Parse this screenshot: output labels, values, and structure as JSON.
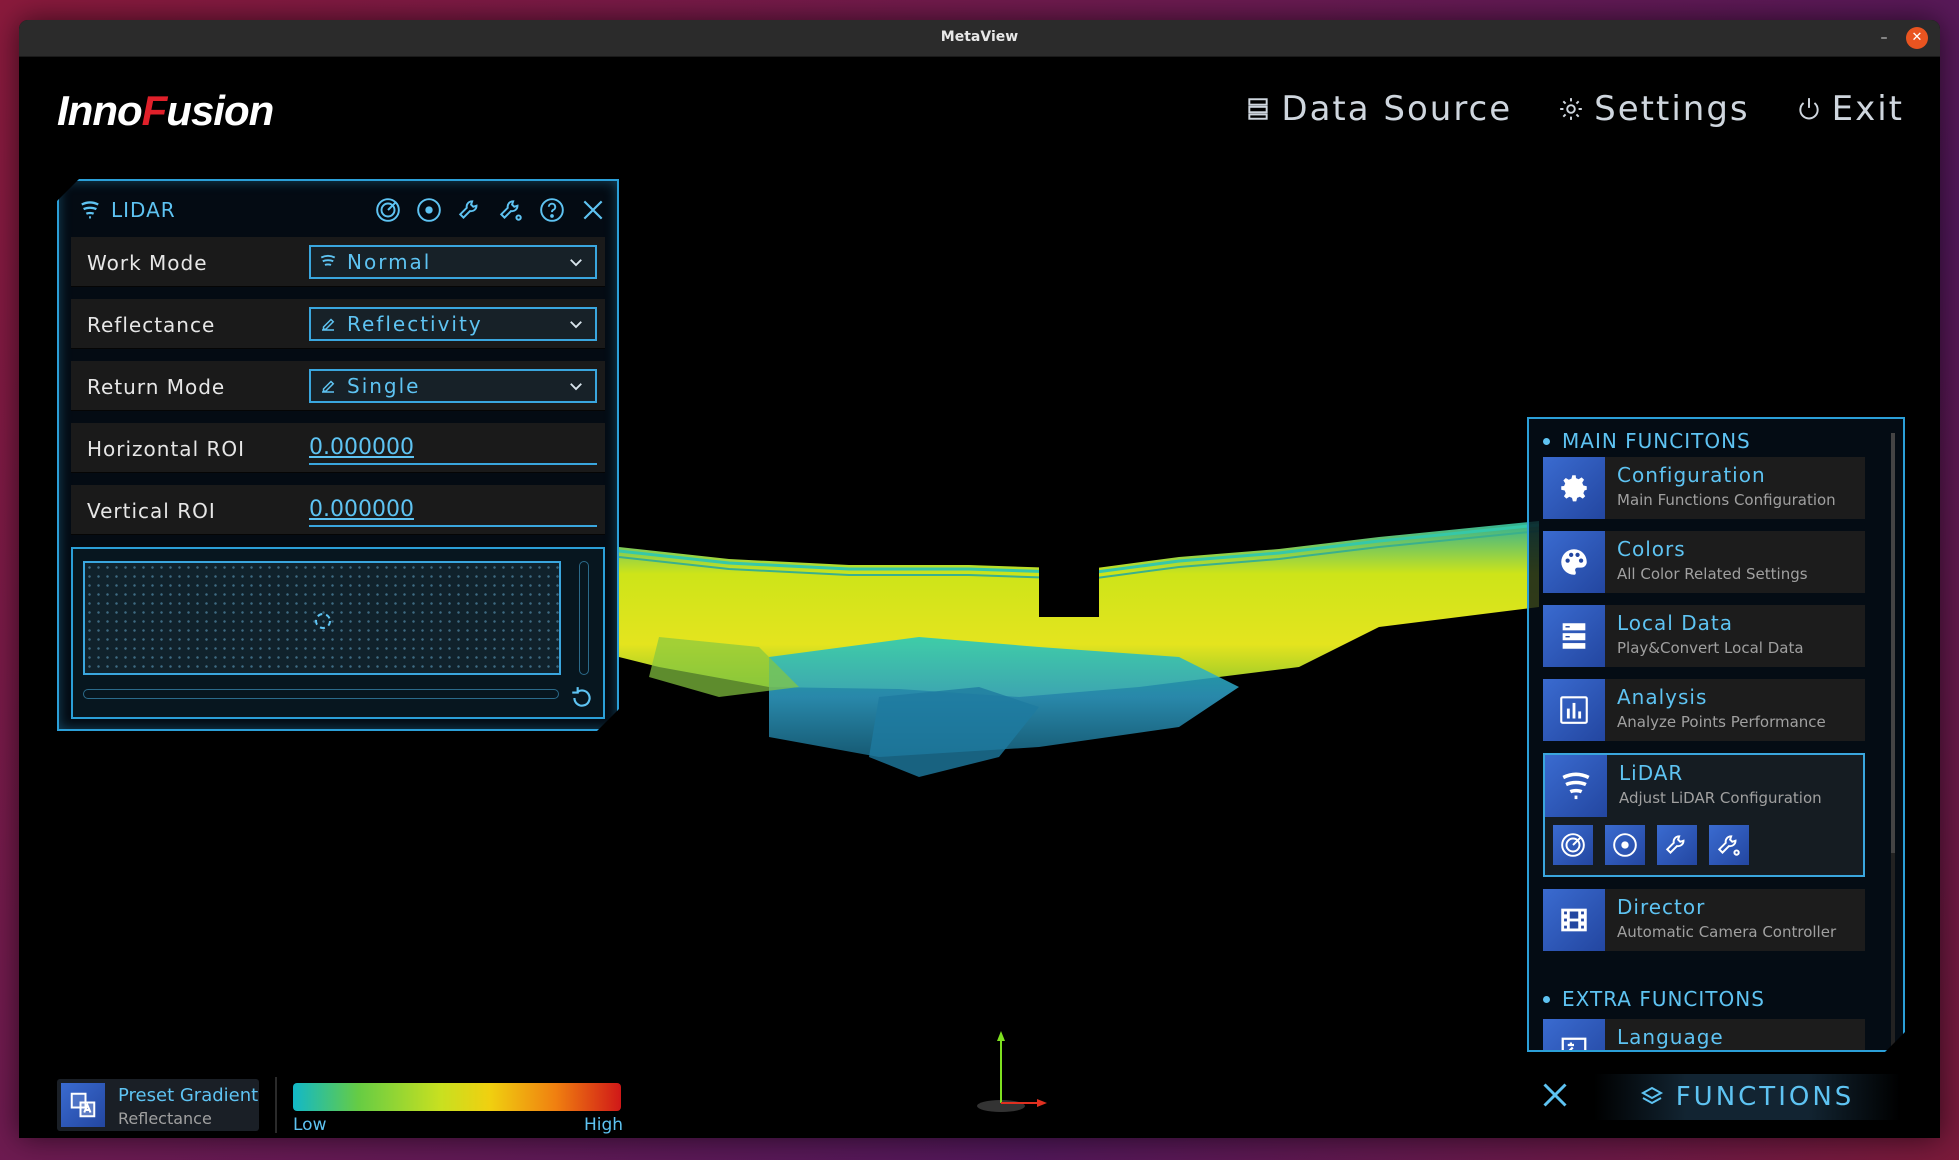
{
  "window": {
    "title": "MetaView",
    "minimize": "–",
    "close": "✕"
  },
  "brand": {
    "logo_prefix": "Inno",
    "logo_mark": "F",
    "logo_suffix": "usion"
  },
  "topnav": [
    {
      "label": "Data Source",
      "icon": "server-icon"
    },
    {
      "label": "Settings",
      "icon": "gear-icon"
    },
    {
      "label": "Exit",
      "icon": "power-icon"
    }
  ],
  "lidar_panel": {
    "title": "LIDAR",
    "rows": {
      "work_mode": {
        "label": "Work Mode",
        "value": "Normal"
      },
      "reflectance": {
        "label": "Reflectance",
        "value": "Reflectivity"
      },
      "return_mode": {
        "label": "Return Mode",
        "value": "Single"
      },
      "horizontal_roi": {
        "label": "Horizontal ROI",
        "value": "0.000000"
      },
      "vertical_roi": {
        "label": "Vertical ROI",
        "value": "0.000000"
      }
    }
  },
  "functions_panel": {
    "main_title": "MAIN FUNCITONS",
    "extra_title": "EXTRA FUNCITONS",
    "cards": [
      {
        "title": "Configuration",
        "subtitle": "Main Functions Configuration",
        "icon": "gear-icon"
      },
      {
        "title": "Colors",
        "subtitle": "All Color Related Settings",
        "icon": "palette-icon"
      },
      {
        "title": "Local Data",
        "subtitle": "Play&Convert Local Data",
        "icon": "database-icon"
      },
      {
        "title": "Analysis",
        "subtitle": "Analyze Points Performance",
        "icon": "bar-chart-icon"
      },
      {
        "title": "LiDAR",
        "subtitle": "Adjust LiDAR Configuration",
        "icon": "wifi-icon"
      },
      {
        "title": "Director",
        "subtitle": "Automatic Camera Controller",
        "icon": "film-icon"
      }
    ],
    "extra_cards": [
      {
        "title": "Language",
        "icon": "language-icon"
      }
    ],
    "button_label": "FUNCTIONS"
  },
  "color_legend": {
    "title": "Preset Gradient",
    "subtitle": "Reflectance",
    "low": "Low",
    "high": "High"
  },
  "colors": {
    "accent": "#5ec3f2",
    "border": "#2b9fd8",
    "close": "#e95420"
  }
}
